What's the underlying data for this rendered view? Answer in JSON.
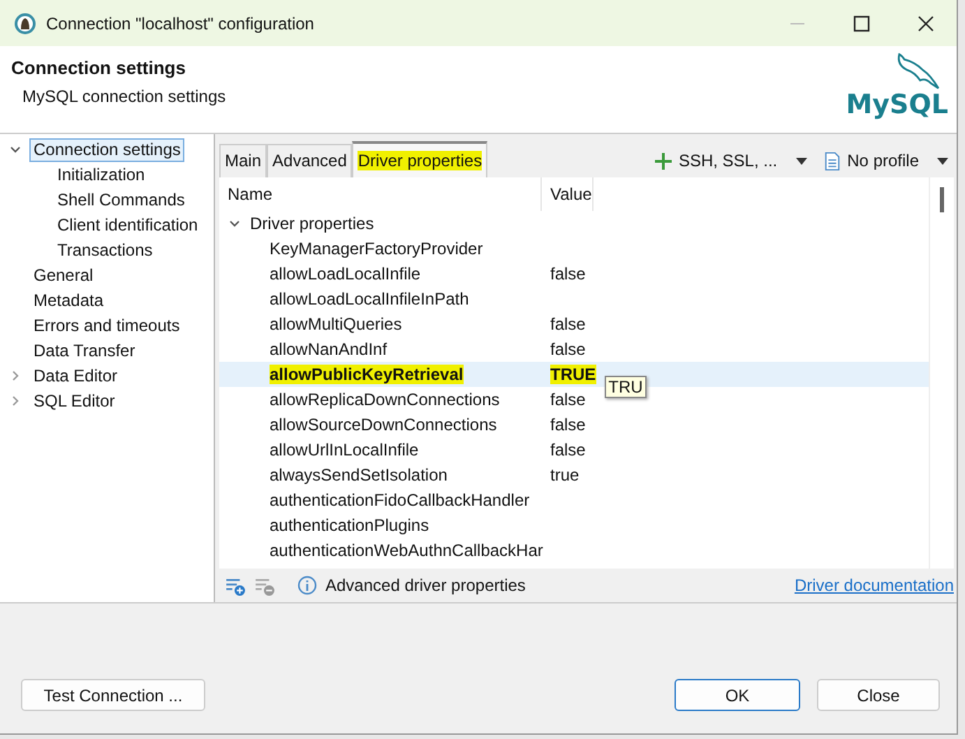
{
  "window": {
    "title": "Connection \"localhost\" configuration"
  },
  "header": {
    "title": "Connection settings",
    "subtitle": "MySQL connection settings",
    "logo_text": "MySQL"
  },
  "sidebar": {
    "items": [
      {
        "label": "Connection settings",
        "selected": true,
        "expanded": true,
        "children": [
          {
            "label": "Initialization",
            "selected": false
          },
          {
            "label": "Shell Commands",
            "selected": false
          },
          {
            "label": "Client identification",
            "selected": false
          },
          {
            "label": "Transactions",
            "selected": false
          }
        ]
      },
      {
        "label": "General",
        "selected": false
      },
      {
        "label": "Metadata",
        "selected": false
      },
      {
        "label": "Errors and timeouts",
        "selected": false
      },
      {
        "label": "Data Transfer",
        "selected": false
      },
      {
        "label": "Data Editor",
        "selected": false,
        "expanded": false
      },
      {
        "label": "SQL Editor",
        "selected": false,
        "expanded": false
      }
    ]
  },
  "tabs": [
    {
      "label": "Main",
      "selected": false
    },
    {
      "label": "Advanced",
      "selected": false
    },
    {
      "label": "Driver properties",
      "selected": true
    }
  ],
  "toolbar": {
    "network_button": "SSH, SSL, ...",
    "profile_button": "No profile"
  },
  "table": {
    "columns": [
      "Name",
      "Value"
    ],
    "group": {
      "label": "Driver properties",
      "expanded": true
    },
    "rows": [
      {
        "name": "KeyManagerFactoryProvider",
        "value": "",
        "selected": false
      },
      {
        "name": "allowLoadLocalInfile",
        "value": "false",
        "selected": false
      },
      {
        "name": "allowLoadLocalInfileInPath",
        "value": "",
        "selected": false
      },
      {
        "name": "allowMultiQueries",
        "value": "false",
        "selected": false
      },
      {
        "name": "allowNanAndInf",
        "value": "false",
        "selected": false
      },
      {
        "name": "allowPublicKeyRetrieval",
        "value": "TRUE",
        "selected": true
      },
      {
        "name": "allowReplicaDownConnections",
        "value": "false",
        "selected": false
      },
      {
        "name": "allowSourceDownConnections",
        "value": "false",
        "selected": false
      },
      {
        "name": "allowUrlInLocalInfile",
        "value": "false",
        "selected": false
      },
      {
        "name": "alwaysSendSetIsolation",
        "value": "true",
        "selected": false
      },
      {
        "name": "authenticationFidoCallbackHandler",
        "value": "",
        "selected": false
      },
      {
        "name": "authenticationPlugins",
        "value": "",
        "selected": false
      },
      {
        "name": "authenticationWebAuthnCallbackHar",
        "value": "",
        "selected": false
      }
    ]
  },
  "tooltip": "TRU",
  "table_footer": {
    "info": "Advanced driver properties",
    "link": "Driver documentation"
  },
  "buttons": {
    "test": "Test Connection ...",
    "ok": "OK",
    "close": "Close"
  }
}
